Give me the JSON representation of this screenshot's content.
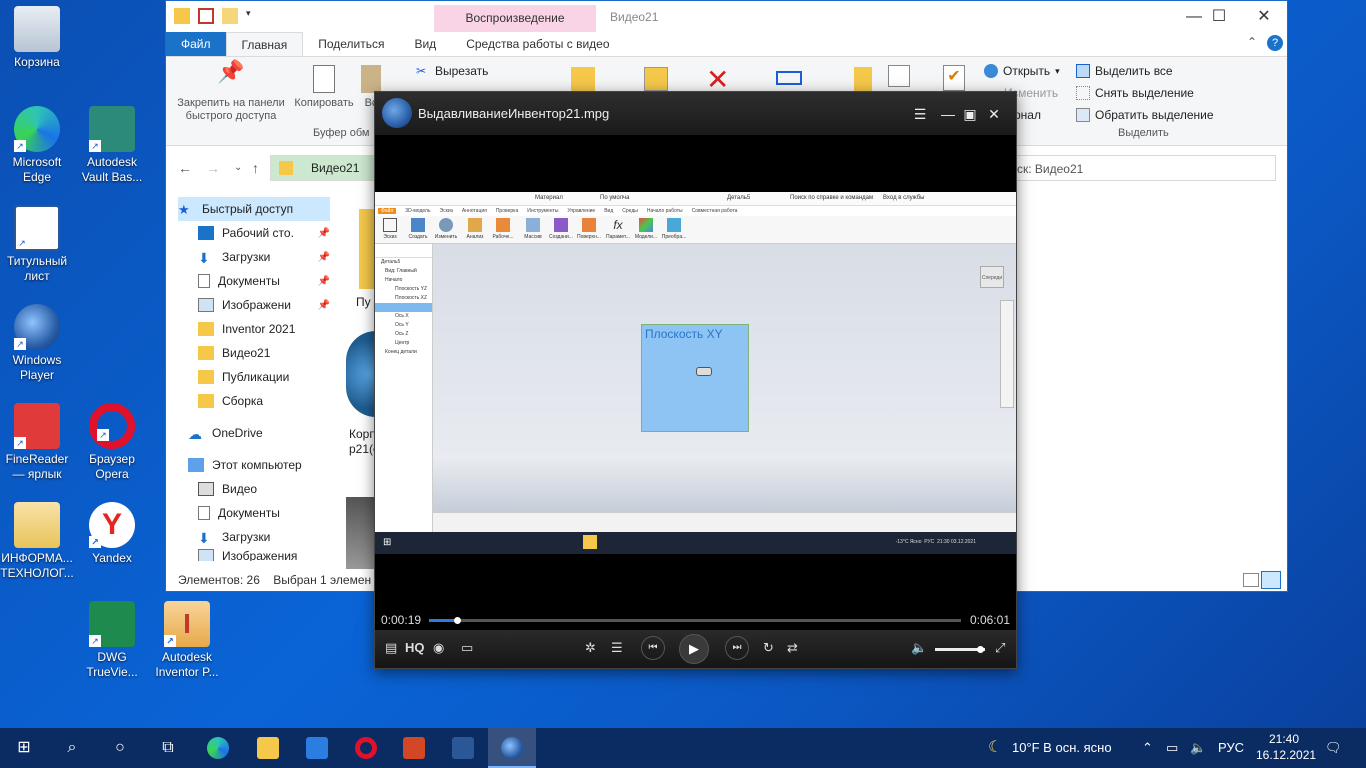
{
  "desktop": {
    "icons": [
      {
        "label": "Корзина"
      },
      {
        "label": "Microsoft Edge"
      },
      {
        "label": "Autodesk Vault Bas..."
      },
      {
        "label": "Титульный лист"
      },
      {
        "label": "Windows Player"
      },
      {
        "label": "FineReader — ярлык"
      },
      {
        "label": "Браузер Opera"
      },
      {
        "label": "ИНФОРМА... ТЕХНОЛОГ..."
      },
      {
        "label": "Yandex"
      },
      {
        "label": "DWG TrueVie..."
      },
      {
        "label": "Autodesk Inventor P..."
      }
    ]
  },
  "explorer": {
    "context_tab": "Воспроизведение",
    "title": "Видео21",
    "tabs": [
      "Файл",
      "Главная",
      "Поделиться",
      "Вид",
      "Средства работы с видео"
    ],
    "ribbon": {
      "pin_label": "Закрепить на панели быстрого доступа",
      "copy_label": "Копировать",
      "paste_label": "Вс",
      "cut_label": "Вырезать",
      "clipboard_group": "Буфер обм",
      "open_label": "Открыть",
      "change_label": "Изменить",
      "journal_label": "рнал",
      "select_all": "Выделить все",
      "deselect": "Снять выделение",
      "invert": "Обратить выделение",
      "select_group": "Выделить"
    },
    "address": "Видео21",
    "search_placeholder": "ск: Видео21",
    "nav": [
      {
        "label": "Быстрый доступ",
        "pinned": false
      },
      {
        "label": "Рабочий сто.",
        "pinned": true
      },
      {
        "label": "Загрузки",
        "pinned": true
      },
      {
        "label": "Документы",
        "pinned": true
      },
      {
        "label": "Изображени",
        "pinned": true
      },
      {
        "label": "Inventor 2021",
        "pinned": false
      },
      {
        "label": "Видео21",
        "pinned": false
      },
      {
        "label": "Публикации",
        "pinned": false
      },
      {
        "label": "Сборка",
        "pinned": false
      },
      {
        "label": "OneDrive",
        "pinned": false
      },
      {
        "label": "Этот компьютер",
        "pinned": false
      },
      {
        "label": "Видео",
        "pinned": false
      },
      {
        "label": "Документы",
        "pinned": false
      },
      {
        "label": "Загрузки",
        "pinned": false
      },
      {
        "label": "Изображения",
        "pinned": false
      }
    ],
    "content_partial": [
      "Пу",
      "Корп",
      "р21(е"
    ],
    "status_count": "Элементов: 26",
    "status_selected": "Выбран 1 элемен"
  },
  "player": {
    "title": "ВыдавливаниеИнвентор21.mpg",
    "time_current": "0:00:19",
    "time_total": "0:06:01",
    "progress": 0.053,
    "volume": 0.9,
    "hq_label": "HQ"
  },
  "inventor": {
    "doc_title": "Деталь5",
    "search_help": "Поиск по справке и командам",
    "login": "Вход в службы",
    "material": "Материал",
    "default": "По умолча",
    "tabs": [
      "Файл",
      "3D-модель",
      "Эскиз",
      "Аннотация",
      "Проверка",
      "Инструменты",
      "Управление",
      "Вид",
      "Среды",
      "Начало работы",
      "Совместная работа"
    ],
    "tools": [
      "Эскиз",
      "Создать",
      "Изменить",
      "Анализ",
      "Рабоче...",
      "Массив",
      "Создани...",
      "Поверхн...",
      "Парамет...",
      "Модели...",
      "Преобра..."
    ],
    "tree": [
      "Деталь5",
      "Вид: Главный",
      "Начало",
      "Плоскость YZ",
      "Плоскость XZ",
      "Плоскость XY",
      "Ось X",
      "Ось Y",
      "Ось Z",
      "Центр",
      "Конец детали"
    ],
    "plane_label": "Плоскость XY",
    "viewcube": "Спереди",
    "tray_weather": "-13°C Ясно",
    "tray_lang": "РУС",
    "tray_time": "21:30",
    "tray_date": "03.12.2021"
  },
  "taskbar": {
    "weather": "10°F В осн. ясно",
    "lang": "РУС",
    "time": "21:40",
    "date": "16.12.2021"
  }
}
